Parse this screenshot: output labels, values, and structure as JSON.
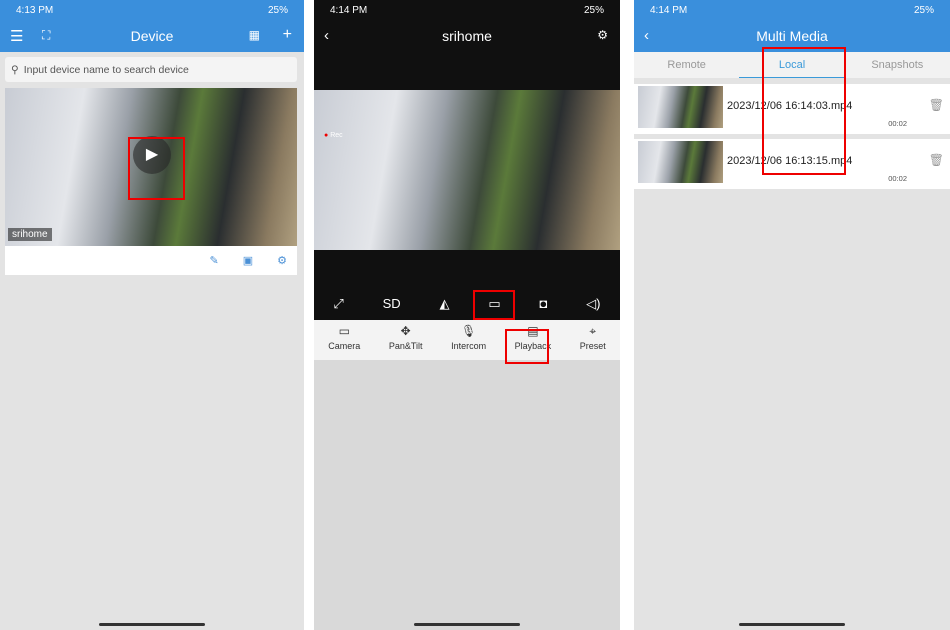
{
  "screen1": {
    "status_time": "4:13 PM",
    "battery": "25%",
    "title": "Device",
    "search_placeholder": "Input device name to search device",
    "device_name": "srihome"
  },
  "screen2": {
    "status_time": "4:14 PM",
    "battery": "25%",
    "title": "srihome",
    "rec_label": "Rec",
    "quality": "SD",
    "menu": [
      "Camera",
      "Pan&Tilt",
      "Intercom",
      "Playback",
      "Preset"
    ]
  },
  "screen3": {
    "status_time": "4:14 PM",
    "battery": "25%",
    "title": "Multi Media",
    "tabs": [
      "Remote",
      "Local",
      "Snapshots"
    ],
    "active_tab": "Local",
    "files": [
      {
        "name": "2023/12/06 16:14:03.mp4",
        "duration": "00:02"
      },
      {
        "name": "2023/12/06 16:13:15.mp4",
        "duration": "00:02"
      }
    ]
  },
  "colors": {
    "accent": "#3a8fdc",
    "highlight": "#ee0000"
  }
}
